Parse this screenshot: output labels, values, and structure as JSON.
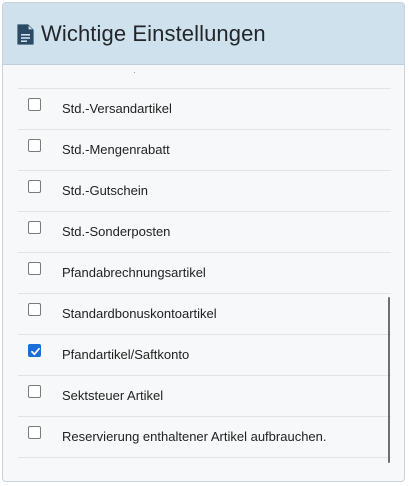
{
  "header": {
    "title": "Wichtige Einstellungen",
    "icon": "document-icon"
  },
  "list": {
    "partial_marker": "·",
    "items": [
      {
        "label": "Std.-Versandartikel",
        "checked": false
      },
      {
        "label": "Std.-Mengenrabatt",
        "checked": false
      },
      {
        "label": "Std.-Gutschein",
        "checked": false
      },
      {
        "label": "Std.-Sonderposten",
        "checked": false
      },
      {
        "label": "Pfandabrechnungsartikel",
        "checked": false
      },
      {
        "label": "Standardbonuskontoartikel",
        "checked": false
      },
      {
        "label": "Pfandartikel/Saftkonto",
        "checked": true
      },
      {
        "label": "Sektsteuer Artikel",
        "checked": false
      },
      {
        "label": "Reservierung enthaltener Artikel aufbrauchen.",
        "checked": false
      }
    ]
  },
  "colors": {
    "header_bg": "#cfe1ec",
    "checkbox_checked": "#1a6fd6",
    "panel_bg": "#f7f8f9"
  }
}
